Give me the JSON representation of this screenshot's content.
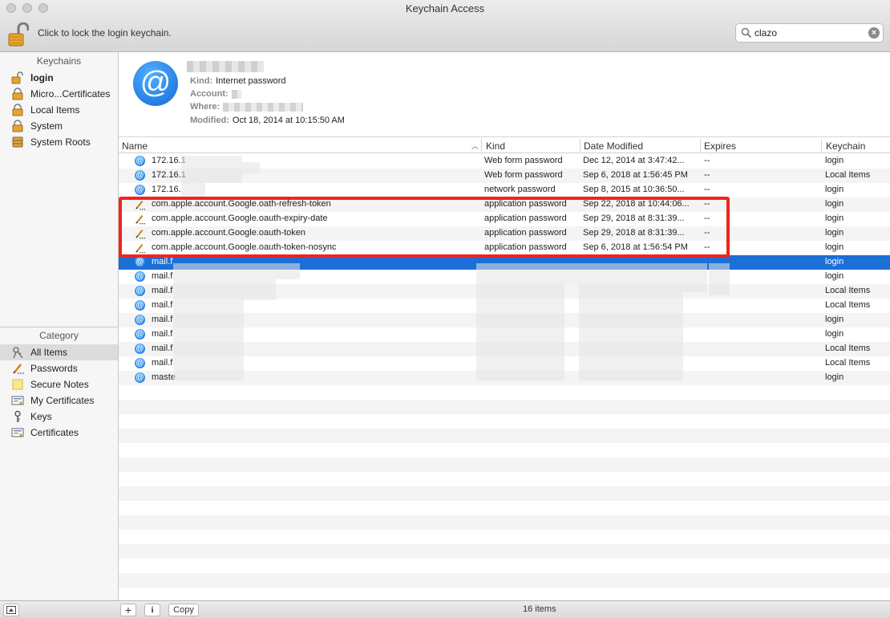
{
  "window": {
    "title": "Keychain Access"
  },
  "toolbar": {
    "lock_text": "Click to lock the login keychain.",
    "search_value": "clazo"
  },
  "sidebar": {
    "keychains_header": "Keychains",
    "keychains": [
      {
        "label": "login",
        "icon": "unlocked-padlock-icon",
        "bold": true
      },
      {
        "label": "Micro...Certificates",
        "icon": "locked-padlock-icon"
      },
      {
        "label": "Local Items",
        "icon": "locked-padlock-icon"
      },
      {
        "label": "System",
        "icon": "locked-padlock-icon"
      },
      {
        "label": "System Roots",
        "icon": "cabinet-icon"
      }
    ],
    "category_header": "Category",
    "categories": [
      {
        "label": "All Items",
        "icon": "all-items-icon",
        "selected": true
      },
      {
        "label": "Passwords",
        "icon": "pen-icon"
      },
      {
        "label": "Secure Notes",
        "icon": "note-icon"
      },
      {
        "label": "My Certificates",
        "icon": "certificate-icon"
      },
      {
        "label": "Keys",
        "icon": "key-icon"
      },
      {
        "label": "Certificates",
        "icon": "certificate-icon"
      }
    ]
  },
  "detail": {
    "icon": "at-sign-icon",
    "kind_label": "Kind:",
    "kind_value": "Internet password",
    "account_label": "Account:",
    "where_label": "Where:",
    "modified_label": "Modified:",
    "modified_value": "Oct 18, 2014 at 10:15:50 AM"
  },
  "table": {
    "columns": [
      "Name",
      "Kind",
      "Date Modified",
      "Expires",
      "Keychain"
    ],
    "rows": [
      {
        "icon": "at-sign-icon",
        "name": "172.16.1",
        "kind": "Web form password",
        "date": "Dec 12, 2014 at 3:47:42...",
        "expires": "--",
        "keychain": "login"
      },
      {
        "icon": "at-sign-icon",
        "name": "172.16.1",
        "kind": "Web form password",
        "date": "Sep 6, 2018 at 1:56:45 PM",
        "expires": "--",
        "keychain": "Local Items"
      },
      {
        "icon": "at-sign-icon",
        "name": "172.16.",
        "kind": "network password",
        "date": "Sep 8, 2015 at 10:36:50...",
        "expires": "--",
        "keychain": "login"
      },
      {
        "icon": "pen-icon",
        "name": "com.apple.account.Google.oath-refresh-token",
        "kind": "application password",
        "date": "Sep 22, 2018 at 10:44:06...",
        "expires": "--",
        "keychain": "login"
      },
      {
        "icon": "pen-icon",
        "name": "com.apple.account.Google.oauth-expiry-date",
        "kind": "application password",
        "date": "Sep 29, 2018 at 8:31:39...",
        "expires": "--",
        "keychain": "login"
      },
      {
        "icon": "pen-icon",
        "name": "com.apple.account.Google.oauth-token",
        "kind": "application password",
        "date": "Sep 29, 2018 at 8:31:39...",
        "expires": "--",
        "keychain": "login"
      },
      {
        "icon": "pen-icon",
        "name": "com.apple.account.Google.oauth-token-nosync",
        "kind": "application password",
        "date": "Sep 6, 2018 at 1:56:54 PM",
        "expires": "--",
        "keychain": "login"
      },
      {
        "icon": "at-sign-icon",
        "name": "mail.f",
        "kind": "",
        "date": "",
        "expires": "",
        "keychain": "login",
        "selected": true
      },
      {
        "icon": "at-sign-icon",
        "name": "mail.f",
        "kind": "",
        "date": "",
        "expires": "",
        "keychain": "login"
      },
      {
        "icon": "at-sign-icon",
        "name": "mail.f",
        "kind": "",
        "date": "",
        "expires": "",
        "keychain": "Local Items"
      },
      {
        "icon": "at-sign-icon",
        "name": "mail.f",
        "kind": "",
        "date": "",
        "expires": "",
        "keychain": "Local Items"
      },
      {
        "icon": "at-sign-icon",
        "name": "mail.f",
        "kind": "",
        "date": "",
        "expires": "",
        "keychain": "login"
      },
      {
        "icon": "at-sign-icon",
        "name": "mail.f",
        "kind": "",
        "date": "",
        "expires": "",
        "keychain": "login"
      },
      {
        "icon": "at-sign-icon",
        "name": "mail.f",
        "kind": "",
        "date": "",
        "expires": "",
        "keychain": "Local Items"
      },
      {
        "icon": "at-sign-icon",
        "name": "mail.f",
        "kind": "",
        "date": "",
        "expires": "",
        "keychain": "Local Items"
      },
      {
        "icon": "at-sign-icon",
        "name": "maste",
        "kind": "",
        "date": "",
        "expires": "",
        "keychain": "login"
      }
    ]
  },
  "bottombar": {
    "add_label": "+",
    "info_label": "i",
    "copy_label": "Copy",
    "count_text": "16 items"
  },
  "colors": {
    "selection": "#1c6fd6",
    "highlight_box": "#f2241c",
    "at_icon": "#1a6ed8"
  }
}
